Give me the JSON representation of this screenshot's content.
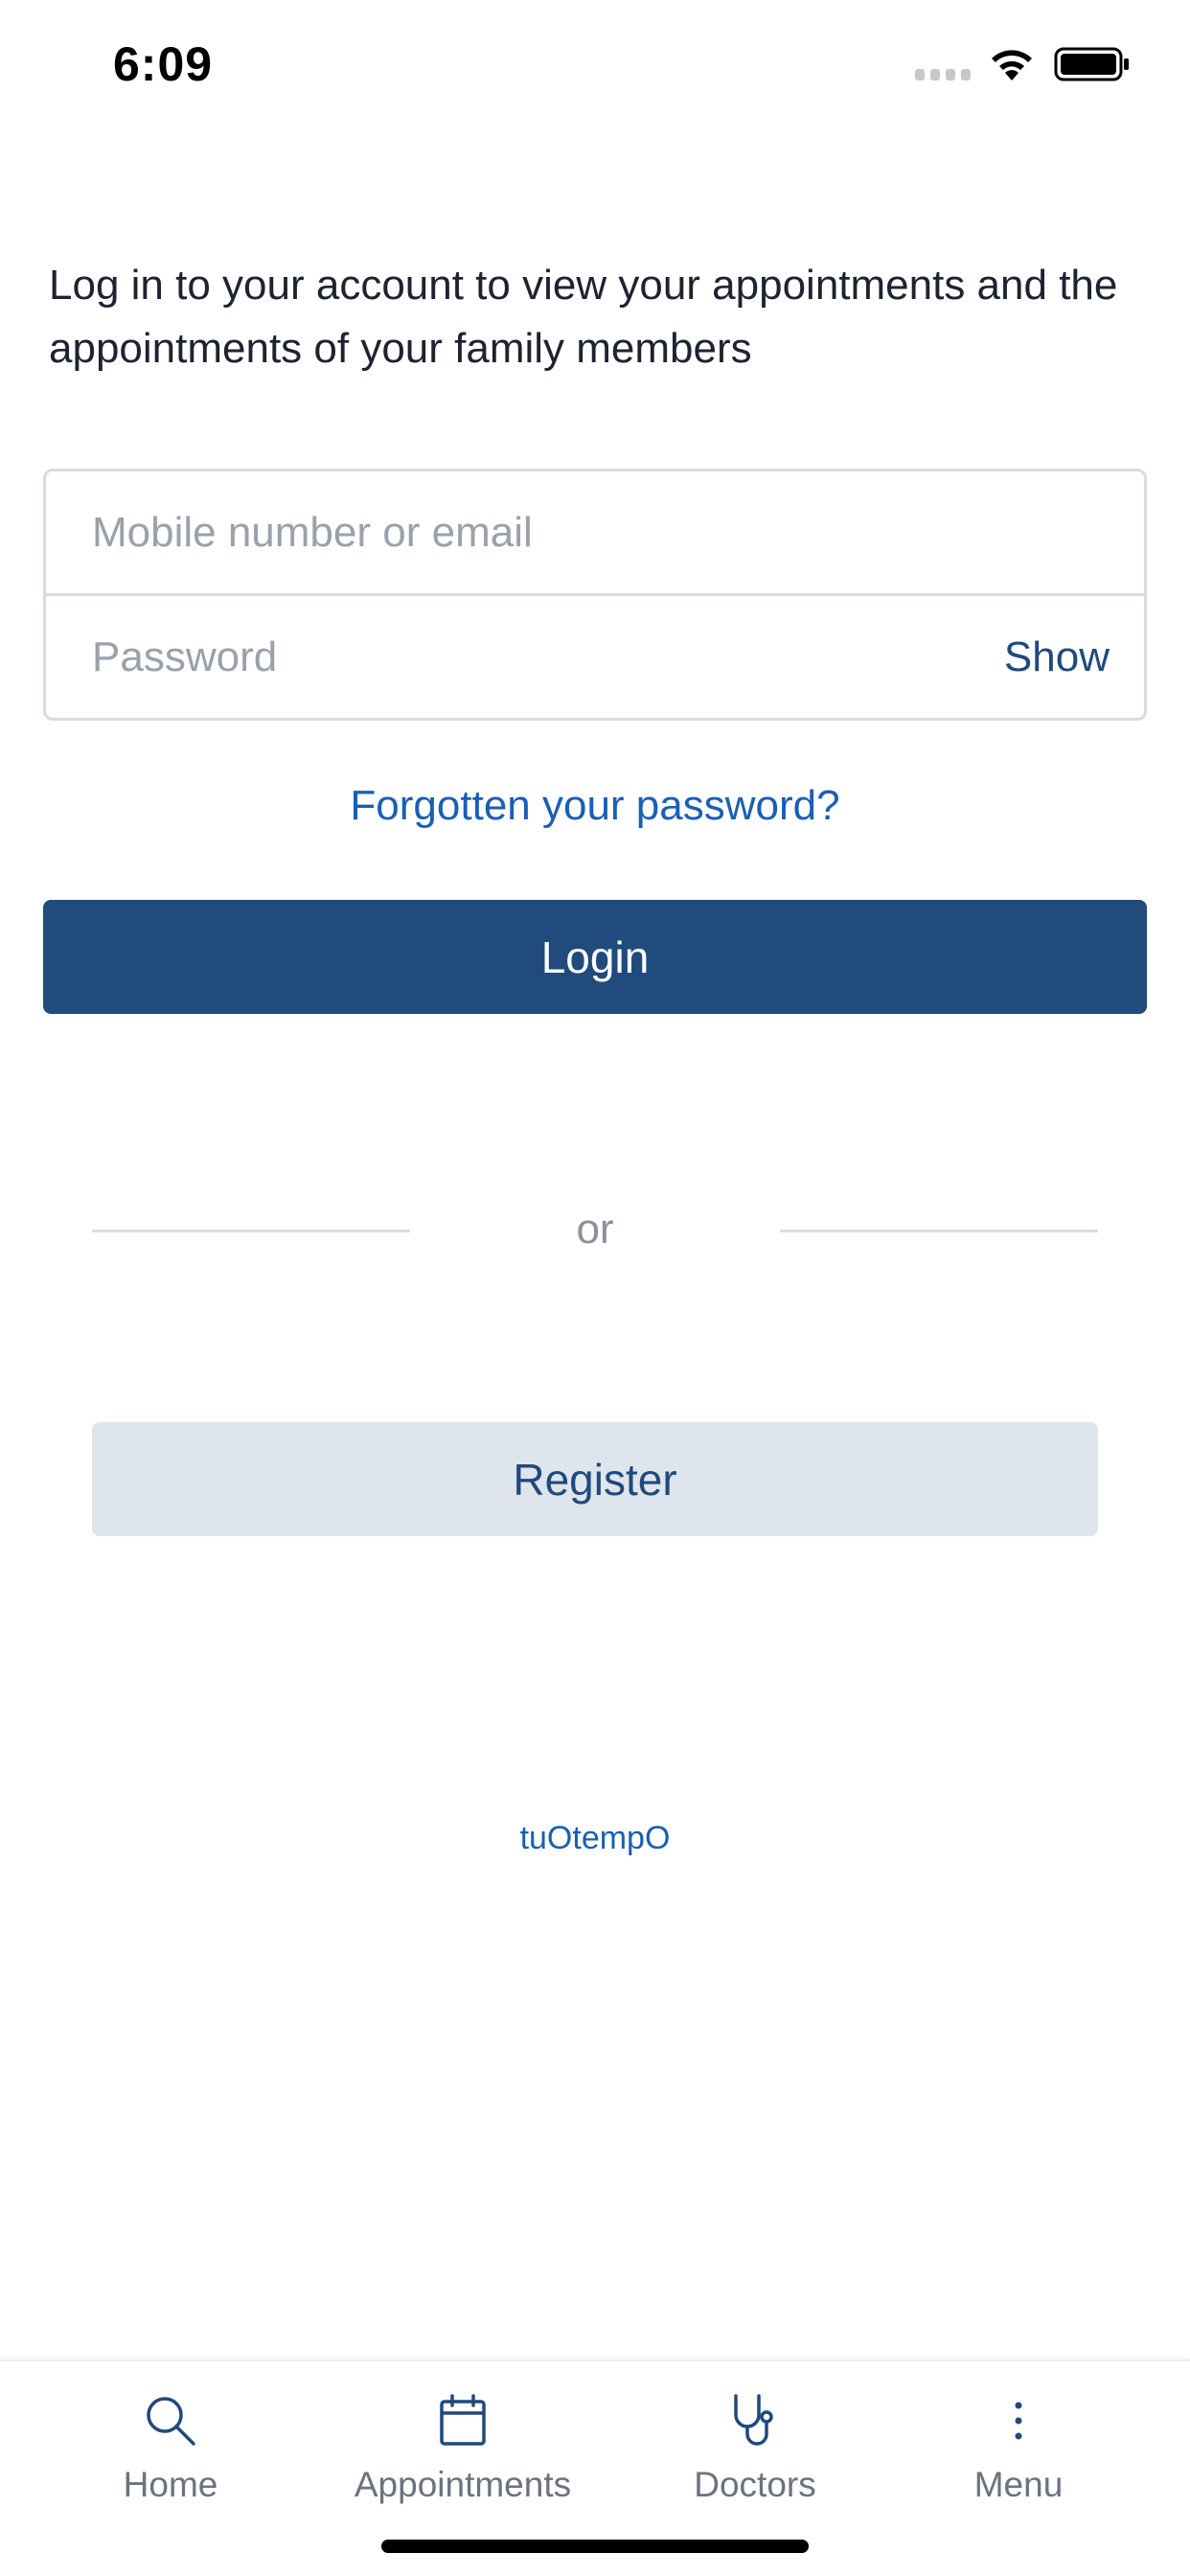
{
  "status_bar": {
    "time": "6:09",
    "icons": [
      "signal-icon",
      "wifi-icon",
      "battery-icon"
    ]
  },
  "intro": {
    "text": "Log in to your account to view your appointments and the appointments of your family members"
  },
  "login_form": {
    "username_placeholder": "Mobile number or email",
    "username_value": "",
    "password_placeholder": "Password",
    "password_value": "",
    "show_label": "Show",
    "forgot_label": "Forgotten your password?",
    "login_label": "Login"
  },
  "separator": {
    "text": "or"
  },
  "register": {
    "label": "Register"
  },
  "brand": {
    "text": "tuOtempO"
  },
  "tab_bar": {
    "items": [
      {
        "label": "Home",
        "icon": "search-icon"
      },
      {
        "label": "Appointments",
        "icon": "calendar-icon"
      },
      {
        "label": "Doctors",
        "icon": "stethoscope-icon"
      },
      {
        "label": "Menu",
        "icon": "more-vertical-icon"
      }
    ]
  },
  "colors": {
    "primary": "#204b7c",
    "link": "#1a5fb4",
    "register_bg": "#dfe5ed",
    "text": "#1d2330",
    "placeholder": "#9aa1ab",
    "tab_icon": "#1f4a7c",
    "tab_label": "#6b7280"
  }
}
